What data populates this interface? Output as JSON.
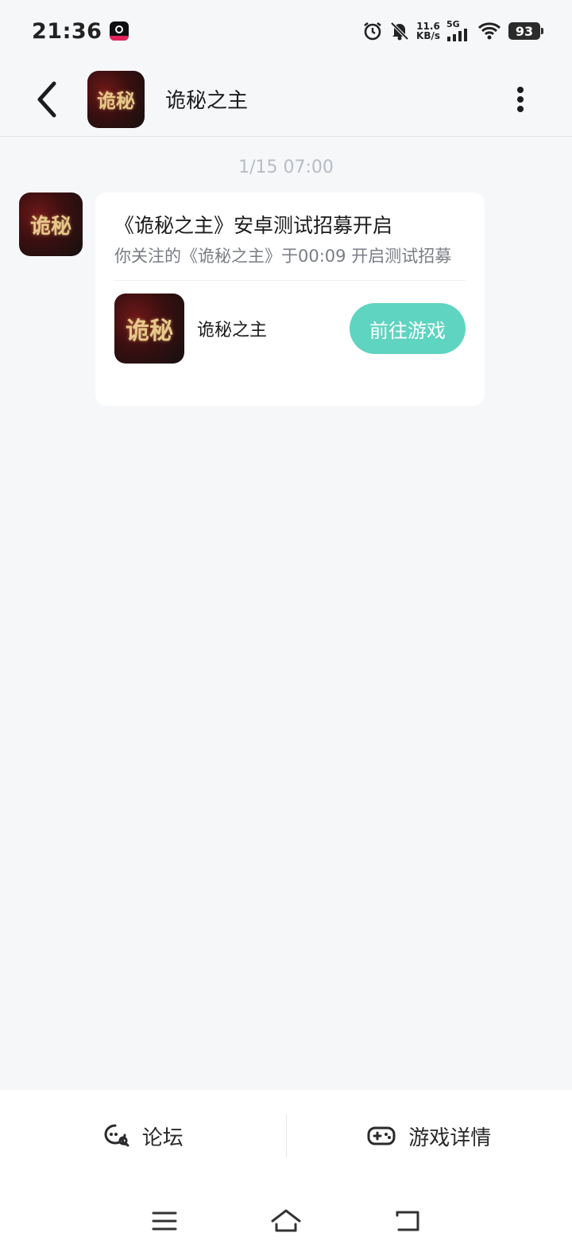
{
  "status_bar": {
    "time": "21:36",
    "net_speed_value": "11.6",
    "net_speed_unit": "KB/s",
    "signal_label": "5G",
    "battery": "93",
    "icons": [
      "app-notification-icon",
      "alarm-icon",
      "bell-muted-icon",
      "signal-icon",
      "wifi-icon",
      "battery-icon"
    ]
  },
  "header": {
    "title": "诡秘之主",
    "avatar_text": "诡秘"
  },
  "chat": {
    "timestamp": "1/15  07:00",
    "message": {
      "title": "《诡秘之主》安卓测试招募开启",
      "description": "你关注的《诡秘之主》于00:09 开启测试招募",
      "game_name": "诡秘之主",
      "game_avatar_text": "诡秘",
      "action_label": "前往游戏"
    }
  },
  "bottom_bar": {
    "forum_label": "论坛",
    "details_label": "游戏详情"
  },
  "colors": {
    "accent": "#5fd4c0",
    "background": "#f6f7f9"
  }
}
